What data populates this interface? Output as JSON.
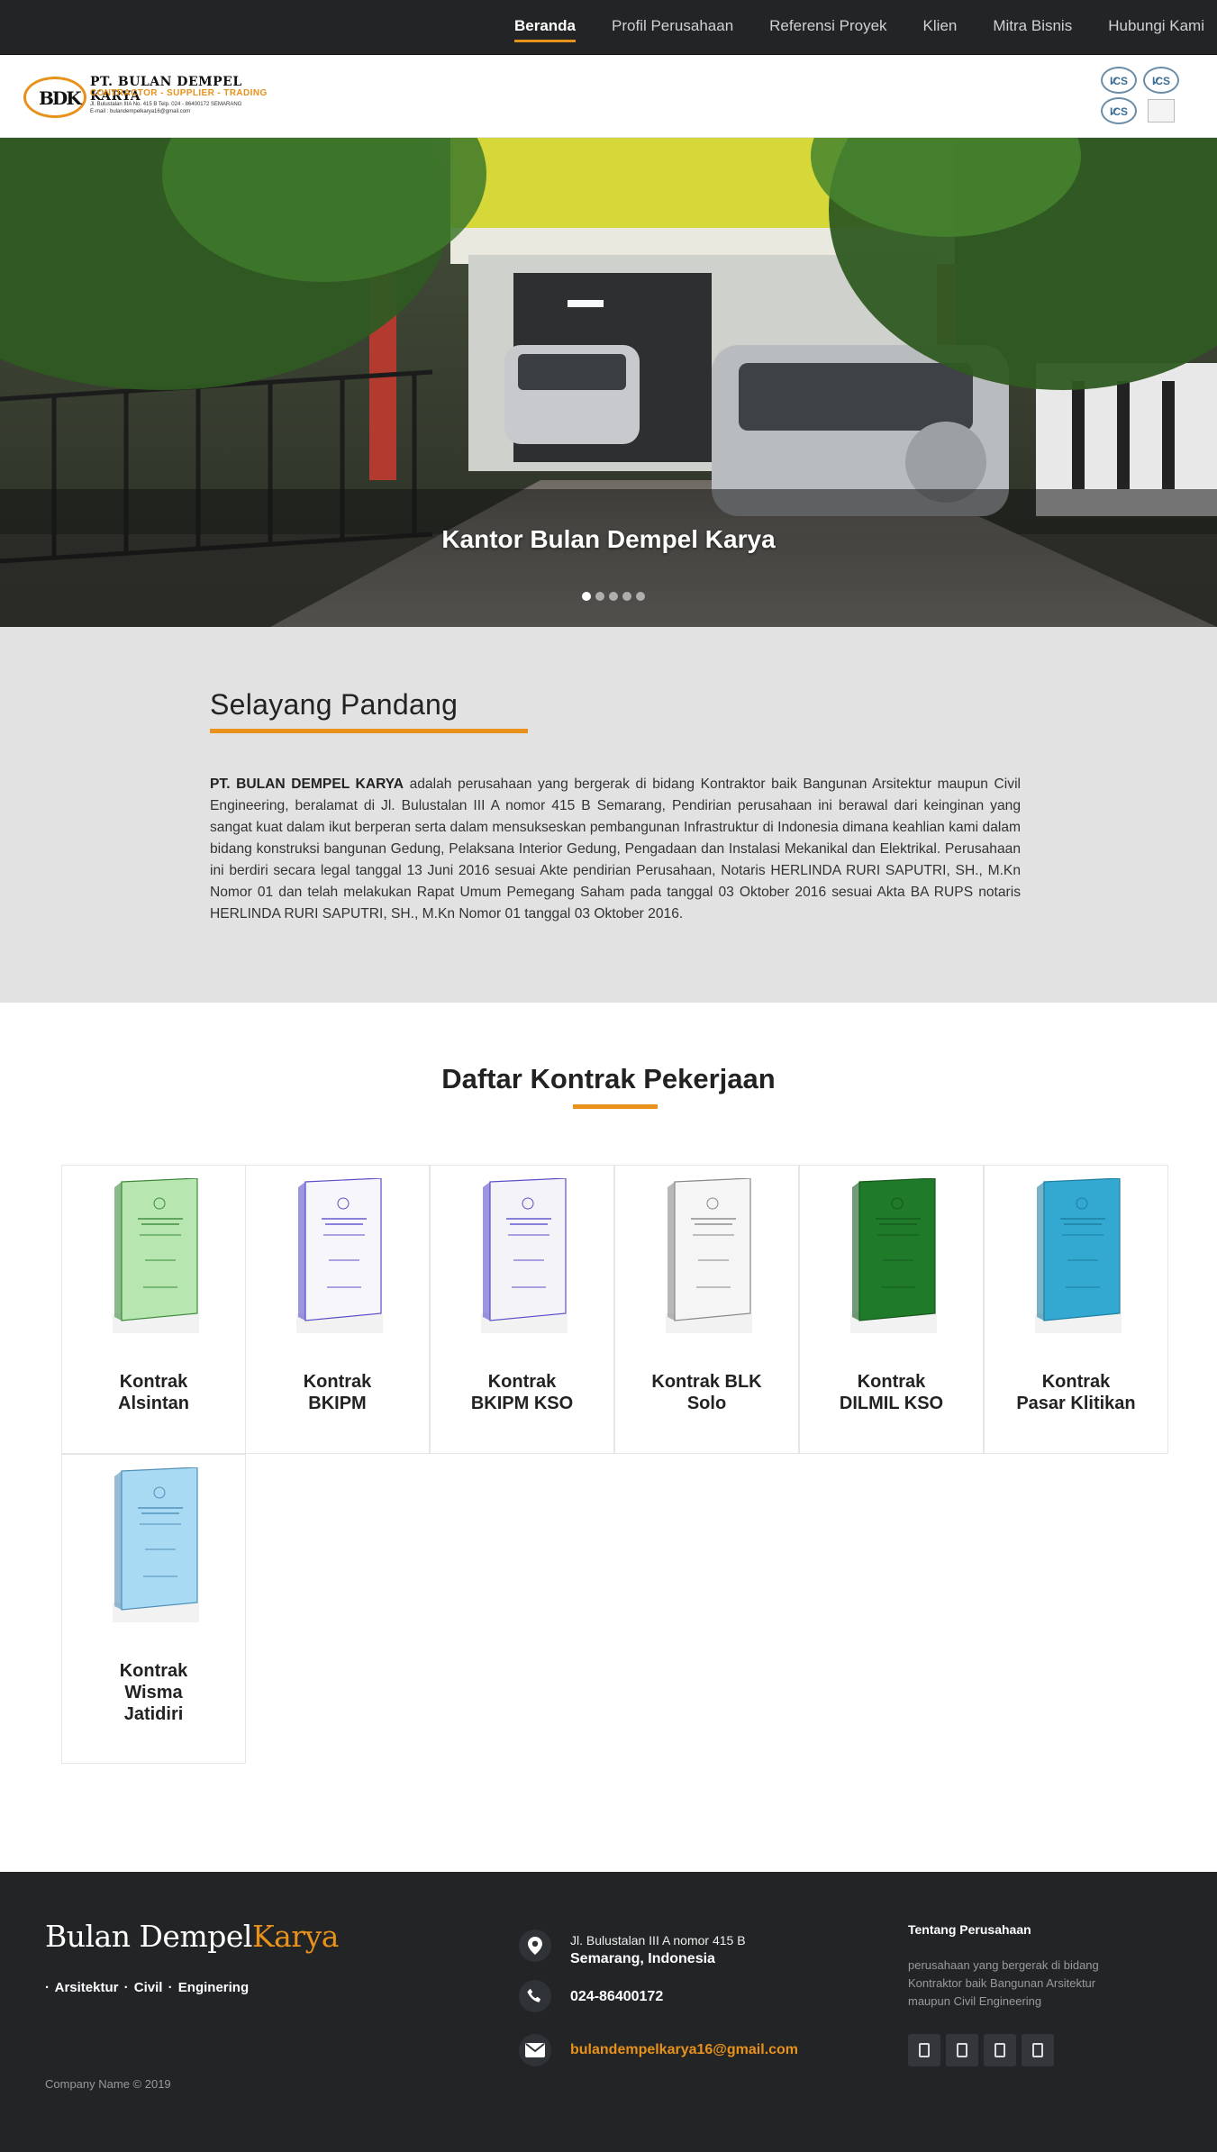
{
  "nav": {
    "items": [
      {
        "label": "Beranda",
        "active": true
      },
      {
        "label": "Profil Perusahaan",
        "active": false
      },
      {
        "label": "Referensi Proyek",
        "active": false
      },
      {
        "label": "Klien",
        "active": false
      },
      {
        "label": "Mitra Bisnis",
        "active": false
      },
      {
        "label": "Hubungi Kami",
        "active": false
      }
    ]
  },
  "header": {
    "logo_mark": "BDK",
    "logo_name": "PT. BULAN DEMPEL KARYA",
    "logo_sub": "CONTRACTOR - SUPPLIER - TRADING",
    "logo_addr": "Jl. Bulustalan IIIA No. 415 B  Telp. 024 - 86400172  SEMARANG",
    "logo_email": "E-mail : bulandempelkarya16@gmail.com",
    "cert_label": "ICS"
  },
  "hero": {
    "caption": "Kantor Bulan Dempel Karya",
    "slide_count": 5,
    "active_slide": 0
  },
  "about": {
    "title": "Selayang Pandang",
    "company_bold": "PT. BULAN DEMPEL KARYA",
    "body": " adalah perusahaan yang bergerak di bidang Kontraktor baik Bangunan Arsitektur maupun Civil Engineering, beralamat di Jl. Bulustalan III A nomor 415 B Semarang, Pendirian perusahaan ini berawal dari keinginan yang sangat kuat dalam ikut berperan serta dalam mensukseskan pembangunan Infrastruktur di Indonesia dimana keahlian kami dalam bidang konstruksi bangunan Gedung, Pelaksana Interior Gedung, Pengadaan dan Instalasi Mekanikal dan Elektrikal. Perusahaan ini berdiri secara legal tanggal 13 Juni 2016 sesuai Akte pendirian Perusahaan, Notaris HERLINDA RURI SAPUTRI, SH., M.Kn Nomor 01 dan telah melakukan Rapat Umum Pemegang Saham pada tanggal 03 Oktober 2016 sesuai Akta BA RUPS notaris HERLINDA RURI SAPUTRI, SH., M.Kn Nomor 01 tanggal 03 Oktober 2016."
  },
  "contracts": {
    "title": "Daftar Kontrak Pekerjaan",
    "items": [
      {
        "line1": "Kontrak",
        "line2": "Alsintan",
        "line3": "",
        "cover": "#b8e6b0",
        "accent": "#3c8a3c"
      },
      {
        "line1": "Kontrak",
        "line2": "BKIPM",
        "line3": "",
        "cover": "#f7f7fb",
        "accent": "#5b4fc9"
      },
      {
        "line1": "Kontrak",
        "line2": "BKIPM KSO",
        "line3": "",
        "cover": "#f4f4f8",
        "accent": "#5b4fc9"
      },
      {
        "line1": "Kontrak BLK",
        "line2": "Solo",
        "line3": "",
        "cover": "#f5f5f5",
        "accent": "#888888"
      },
      {
        "line1": "Kontrak",
        "line2": "DILMIL KSO",
        "line3": "",
        "cover": "#1f7a2a",
        "accent": "#145a1c"
      },
      {
        "line1": "Kontrak",
        "line2": "Pasar Klitikan",
        "line3": "",
        "cover": "#33a9d1",
        "accent": "#1d7ea1"
      },
      {
        "line1": "Kontrak",
        "line2": "Wisma",
        "line3": "Jatidiri",
        "cover": "#a9daf4",
        "accent": "#4f8fb8"
      }
    ]
  },
  "footer": {
    "brand_main": "Bulan Dempel",
    "brand_accent": "Karya",
    "tags": "· Arsitektur ·  Civil ·  Enginering",
    "copyright": "Company Name © 2019",
    "address_line1": "Jl. Bulustalan III A nomor 415 B",
    "address_line2": "Semarang, Indonesia",
    "phone": "024-86400172",
    "email": "bulandempelkarya16@gmail.com",
    "about_title": "Tentang Perusahaan",
    "about_text": "perusahaan yang bergerak di bidang Kontraktor baik Bangunan Arsitektur maupun Civil Engineering",
    "social_icons": [
      "social-icon-1",
      "social-icon-2",
      "social-icon-3",
      "social-icon-4"
    ]
  },
  "colors": {
    "accent": "#e8911b",
    "nav_bg": "#222426",
    "about_bg": "#e2e2e2",
    "footer_bg": "#222426"
  }
}
